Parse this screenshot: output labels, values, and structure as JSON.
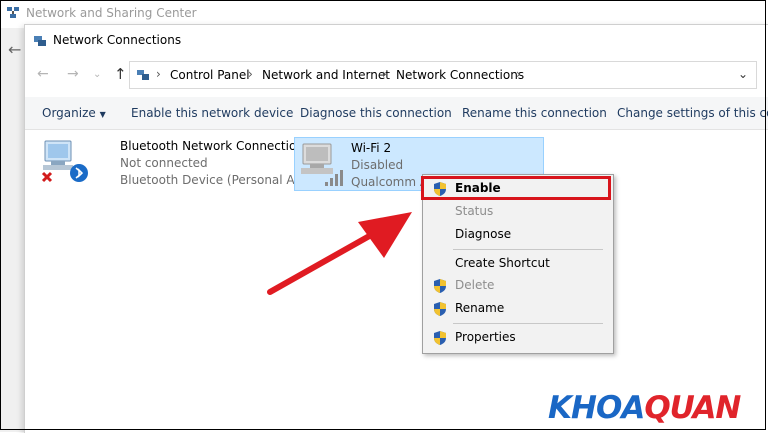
{
  "back_window": {
    "title": "Network and Sharing Center"
  },
  "window": {
    "title": "Network Connections"
  },
  "address": {
    "crumbs": [
      "Control Panel",
      "Network and Internet",
      "Network Connections"
    ]
  },
  "toolbar": {
    "organize": "Organize",
    "enable_device": "Enable this network device",
    "diagnose": "Diagnose this connection",
    "rename": "Rename this connection",
    "change_settings": "Change settings of this conn"
  },
  "connections": [
    {
      "name": "Bluetooth Network Connection",
      "status": "Not connected",
      "device": "Bluetooth Device (Personal Area ..."
    },
    {
      "name": "Wi-Fi 2",
      "status": "Disabled",
      "device": "Qualcomm A"
    }
  ],
  "context_menu": {
    "enable": "Enable",
    "status": "Status",
    "diagnose": "Diagnose",
    "create_shortcut": "Create Shortcut",
    "delete": "Delete",
    "rename": "Rename",
    "properties": "Properties"
  },
  "logo": {
    "part1": "KHOA",
    "part2": "QUAN"
  },
  "colors": {
    "highlight": "#d8151c",
    "selection": "#cce8ff",
    "arrow": "#e01b22",
    "logo_blue": "#1a67c5",
    "logo_red": "#e0242b"
  }
}
